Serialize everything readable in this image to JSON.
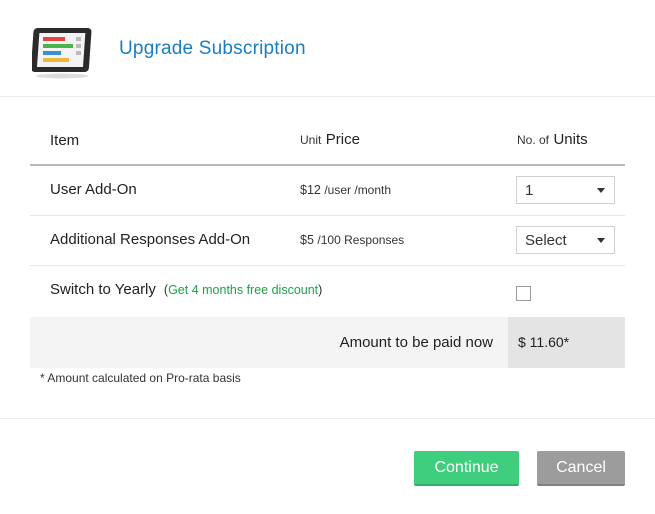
{
  "dialog": {
    "title": "Upgrade Subscription",
    "icon": "tablet-checklist-icon"
  },
  "table": {
    "headers": {
      "item": "Item",
      "price_small": "Unit",
      "price_big": "Price",
      "units_small": "No. of",
      "units_big": "Units"
    },
    "rows": [
      {
        "label": "User Add-On",
        "price_main": "$12",
        "price_suffix": "/user /month",
        "select_value": "1"
      },
      {
        "label": "Additional Responses Add-On",
        "price_main": "$5",
        "price_suffix": "/100 Responses",
        "select_value": "Select"
      }
    ],
    "yearly": {
      "label": "Switch to Yearly",
      "note_open": "(",
      "note_green": "Get 4 months free discount",
      "note_close": ")",
      "checked": false
    }
  },
  "amount": {
    "label": "Amount to be paid now",
    "value": "$ 11.60*"
  },
  "footnote": "* Amount calculated on Pro-rata basis",
  "buttons": {
    "continue": "Continue",
    "cancel": "Cancel"
  },
  "colors": {
    "title": "#1b7ec2",
    "continue": "#3fcd7e",
    "cancel": "#9c9c9c",
    "discount_note": "#1aa34a"
  }
}
